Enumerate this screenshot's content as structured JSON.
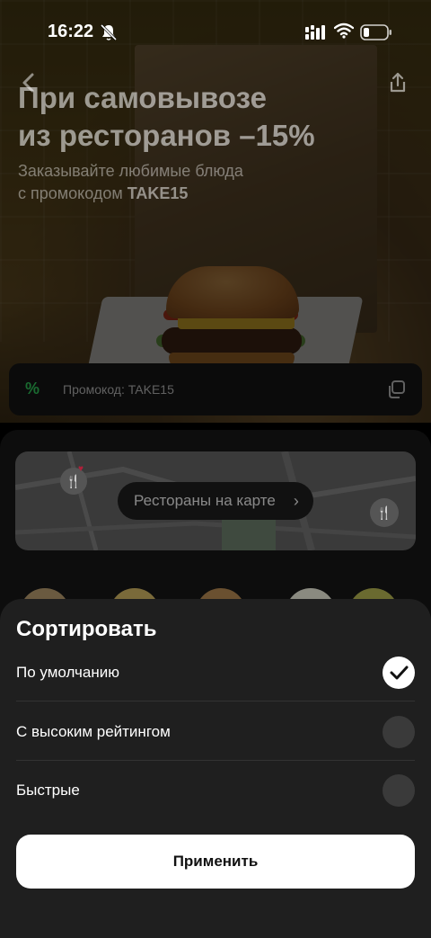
{
  "status_bar": {
    "time": "16:22"
  },
  "hero": {
    "title_line1": "При самовывозе",
    "title_line2": "из ресторанов –15%",
    "subtitle_line1": "Заказывайте любимые блюда",
    "subtitle_prefix": "с промокодом ",
    "promo_code_bold": "TAKE15"
  },
  "promo": {
    "icon": "%",
    "label": "Промокод: TAKE15"
  },
  "map": {
    "button_label": "Рестораны на карте",
    "chevron": "›"
  },
  "sort_sheet": {
    "title": "Сортировать",
    "options": [
      {
        "label": "По умолчанию",
        "selected": true
      },
      {
        "label": "С высоким рейтингом",
        "selected": false
      },
      {
        "label": "Быстрые",
        "selected": false
      }
    ],
    "apply_label": "Применить"
  },
  "colors": {
    "sheet_bg": "#1f1f1f",
    "accent_green": "#1a6a30",
    "apply_bg": "#ffffff"
  }
}
